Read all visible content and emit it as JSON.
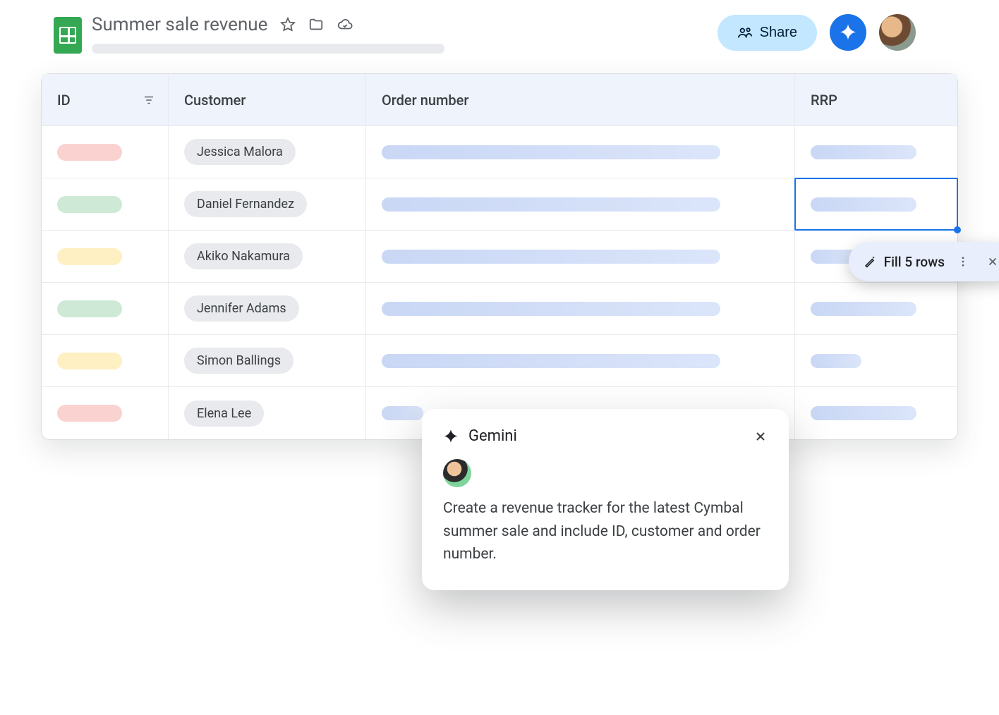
{
  "header": {
    "doc_title": "Summer sale revenue",
    "share_label": "Share"
  },
  "table": {
    "columns": {
      "id": "ID",
      "customer": "Customer",
      "order": "Order number",
      "rrp": "RRP"
    },
    "rows": [
      {
        "id_color": "red",
        "customer": "Jessica Malora"
      },
      {
        "id_color": "green",
        "customer": "Daniel Fernandez"
      },
      {
        "id_color": "yellow",
        "customer": "Akiko Nakamura"
      },
      {
        "id_color": "green",
        "customer": "Jennifer Adams"
      },
      {
        "id_color": "yellow",
        "customer": "Simon Ballings"
      },
      {
        "id_color": "red",
        "customer": "Elena Lee"
      }
    ]
  },
  "autofill": {
    "label": "Fill 5 rows"
  },
  "gemini": {
    "title": "Gemini",
    "prompt": "Create a revenue tracker for the latest Cymbal summer sale and include ID, customer and order number."
  }
}
